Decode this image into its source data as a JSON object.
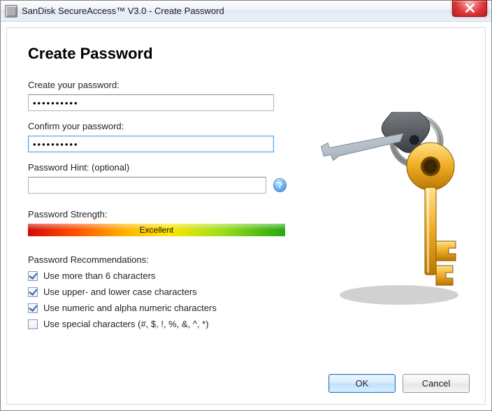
{
  "titlebar": {
    "title": "SanDisk SecureAccess™ V3.0 - Create Password"
  },
  "heading": "Create Password",
  "fields": {
    "create_label": "Create your password:",
    "create_value": "••••••••••",
    "confirm_label": "Confirm your password:",
    "confirm_value": "••••••••••",
    "hint_label": "Password Hint: (optional)",
    "hint_value": ""
  },
  "help_icon_text": "?",
  "strength": {
    "label": "Password Strength:",
    "value": "Excellent"
  },
  "recommendations": {
    "title": "Password Recommendations:",
    "items": [
      {
        "label": "Use more than 6 characters",
        "checked": true
      },
      {
        "label": "Use upper- and lower case characters",
        "checked": true
      },
      {
        "label": "Use numeric and alpha numeric characters",
        "checked": true
      },
      {
        "label": "Use special characters (#, $, !, %, &, ^, *)",
        "checked": false
      }
    ]
  },
  "buttons": {
    "ok": "OK",
    "cancel": "Cancel"
  }
}
